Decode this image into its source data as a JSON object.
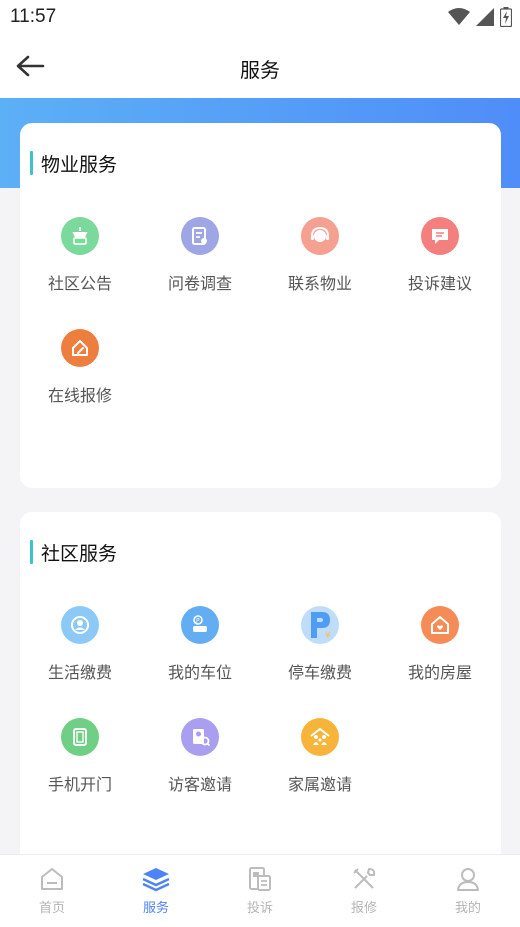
{
  "status": {
    "time": "11:57"
  },
  "header": {
    "title": "服务"
  },
  "colors": {
    "accent": "#4d84f5",
    "section_bar": "#3cc3c8",
    "band_start": "#5cb0f6",
    "band_end": "#4f8df8"
  },
  "sections": [
    {
      "title": "物业服务",
      "items": [
        {
          "label": "社区公告",
          "icon": "announcement-icon",
          "color": "#7bd99b"
        },
        {
          "label": "问卷调查",
          "icon": "survey-icon",
          "color": "#9ea6e6"
        },
        {
          "label": "联系物业",
          "icon": "customer-service-icon",
          "color": "#f6a092"
        },
        {
          "label": "投诉建议",
          "icon": "complaint-icon",
          "color": "#f47f7f"
        },
        {
          "label": "在线报修",
          "icon": "repair-icon",
          "color": "#ee7e3e"
        }
      ]
    },
    {
      "title": "社区服务",
      "items": [
        {
          "label": "生活缴费",
          "icon": "payment-icon",
          "color": "#8cc9f7"
        },
        {
          "label": "我的车位",
          "icon": "parking-spot-icon",
          "color": "#63aef3"
        },
        {
          "label": "停车缴费",
          "icon": "parking-fee-icon",
          "color": "#4e9df2"
        },
        {
          "label": "我的房屋",
          "icon": "house-icon",
          "color": "#f58b56"
        },
        {
          "label": "手机开门",
          "icon": "phone-door-icon",
          "color": "#6fcf84"
        },
        {
          "label": "访客邀请",
          "icon": "visitor-icon",
          "color": "#a99ef0"
        },
        {
          "label": "家属邀请",
          "icon": "family-icon",
          "color": "#f7b43a"
        }
      ]
    }
  ],
  "tabs": [
    {
      "label": "首页",
      "icon": "home-icon",
      "active": false
    },
    {
      "label": "服务",
      "icon": "layers-icon",
      "active": true
    },
    {
      "label": "投诉",
      "icon": "complaint-doc-icon",
      "active": false
    },
    {
      "label": "报修",
      "icon": "tools-icon",
      "active": false
    },
    {
      "label": "我的",
      "icon": "profile-icon",
      "active": false
    }
  ]
}
